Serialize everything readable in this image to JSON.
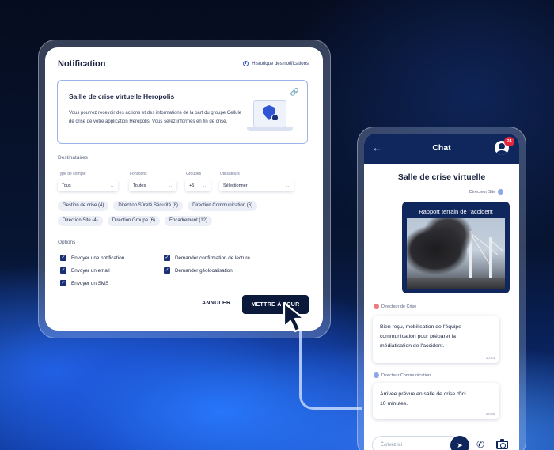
{
  "notification": {
    "title": "Notification",
    "history_link": "Historique des notifications",
    "crisis_room": {
      "title": "Saille de crise virtuelle Heropolis",
      "description": "Vous pourrez recevoir des actions et des informations de la part du groupe Cellule de crise de votre application Heropolis. Vous serez informés en fin de crise."
    },
    "recipients_label": "Destinataires",
    "filters": [
      {
        "label": "Type de compte",
        "value": "Tous"
      },
      {
        "label": "Fonctions",
        "value": "Toutes"
      },
      {
        "label": "Groupes",
        "value": "+5"
      },
      {
        "label": "Utilisateurs",
        "value": "Sélectionner"
      }
    ],
    "chips": [
      "Gestion de crise (4)",
      "Direction Sûreté Sécurité (8)",
      "Direction Communication (6)",
      "Direction Site (4)",
      "Direction Groupe (6)",
      "Encadrement (12)"
    ],
    "chip_add": "+",
    "options_label": "Options",
    "options": [
      {
        "label": "Envoyer une notification",
        "checked": true
      },
      {
        "label": "Envoyer un email",
        "checked": true
      },
      {
        "label": "Envoyer un SMS",
        "checked": true
      },
      {
        "label": "Demander confirmation de lecture",
        "checked": true
      },
      {
        "label": "Demander géolocalisation",
        "checked": true
      }
    ],
    "cancel_label": "ANNULER",
    "update_label": "METTRE À JOUR"
  },
  "chat": {
    "header_title": "Chat",
    "badge_count": "24",
    "room_title": "Salle de crise virtuelle",
    "messages": [
      {
        "sender": "Directeur Site",
        "card_title": "Rapport terrain de l'accident"
      },
      {
        "sender": "Directeur de Crise",
        "text_lines": [
          "Bien reçu, mobilisation de l'équipe",
          "communication pour préparer la",
          "médiatisation de l'accident."
        ],
        "time": "10:24"
      },
      {
        "sender": "Directeur Communication",
        "text_lines": [
          "Arrivée prévue en salle de crise d'ici",
          "10 minutes."
        ],
        "time": "10:28"
      }
    ],
    "composer_placeholder": "Écrivez ici"
  },
  "colors": {
    "navy": "#10275e",
    "accent_blue": "#3657c9",
    "badge_red": "#e3263a",
    "sender_red": "#f07b7b",
    "sender_blue": "#8da8e8"
  }
}
